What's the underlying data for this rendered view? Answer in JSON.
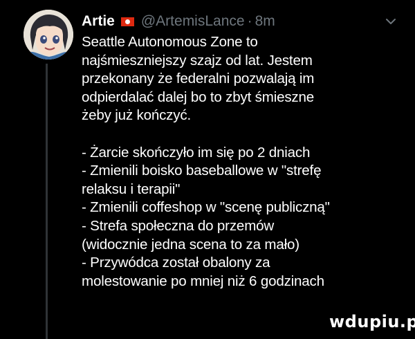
{
  "tweet": {
    "author_name": "Artie",
    "author_flag": "hong-kong-flag-icon",
    "author_handle": "@ArtemisLance",
    "separator": "·",
    "timestamp": "8m",
    "more_icon": "chevron-down-icon",
    "avatar_icon": "anime-avatar",
    "lines": [
      "Seattle Autonomous Zone to",
      "najśmieszniejszy szajz od lat. Jestem",
      "przekonany że federalni pozwalają im",
      "odpierdalać dalej bo to zbyt śmieszne",
      "żeby już kończyć.",
      "",
      "- Żarcie skończyło im się po 2 dniach",
      "- Zmienili boisko baseballowe w \"strefę",
      "relaksu i terapii\"",
      "- Zmienili coffeshop w \"scenę publiczną\"",
      "- Strefa społeczna do przemów",
      "(widocznie jedna scena to za mało)",
      "- Przywódca został obalony za",
      "molestowanie po mniej niż 6 godzinach"
    ]
  },
  "watermark": "wdupiu.pl",
  "colors": {
    "background": "#000000",
    "text": "#ffffff",
    "secondary_text": "#6e767d",
    "thread_line": "#2f3336"
  }
}
